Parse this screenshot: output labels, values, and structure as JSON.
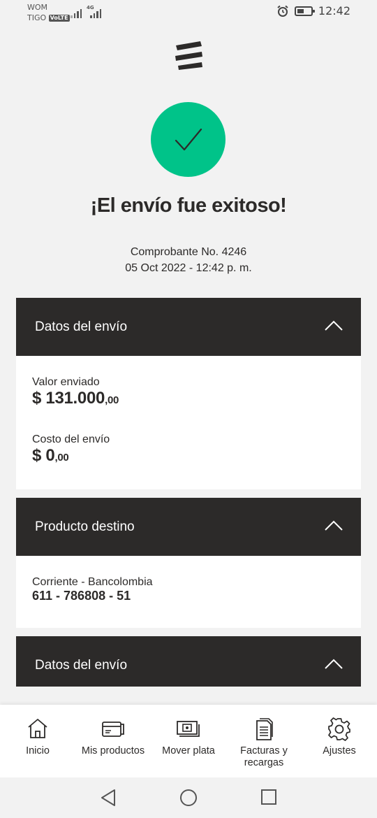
{
  "status_bar": {
    "carrier_1": "WOM",
    "carrier_2": "TIGO",
    "volte": "VoLTE",
    "network": "4G",
    "time": "12:42"
  },
  "title": "¡El envío fue exitoso!",
  "receipt": {
    "number": "Comprobante No. 4246",
    "datetime": "05 Oct 2022 - 12:42 p. m."
  },
  "sections": [
    {
      "header": "Datos del envío",
      "fields": [
        {
          "label": "Valor enviado",
          "value": "$ 131.000",
          "cents": ",00"
        },
        {
          "label": "Costo del envío",
          "value": "$ 0",
          "cents": ",00"
        }
      ]
    },
    {
      "header": "Producto destino",
      "account_type": "Corriente - Bancolombia",
      "account_number": "611 - 786808 - 51"
    },
    {
      "header": "Datos del envío"
    }
  ],
  "bottom_nav": [
    {
      "label": "Inicio",
      "icon": "home-icon"
    },
    {
      "label": "Mis productos",
      "icon": "wallet-icon"
    },
    {
      "label": "Mover plata",
      "icon": "money-icon"
    },
    {
      "label": "Facturas y recargas",
      "icon": "receipt-icon"
    },
    {
      "label": "Ajustes",
      "icon": "gear-icon"
    }
  ],
  "colors": {
    "accent_green": "#00c389",
    "header_dark": "#2c2a29",
    "background": "#f2f2f2"
  }
}
